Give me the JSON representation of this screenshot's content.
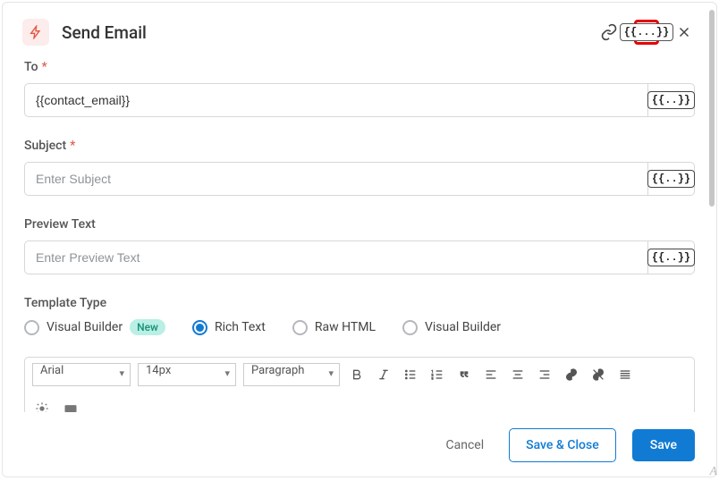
{
  "header": {
    "title": "Send Email"
  },
  "fields": {
    "to": {
      "label": "To",
      "required": true,
      "value": "{{contact_email}}",
      "placeholder": ""
    },
    "subject": {
      "label": "Subject",
      "required": true,
      "value": "",
      "placeholder": "Enter Subject"
    },
    "preview": {
      "label": "Preview Text",
      "required": false,
      "value": "",
      "placeholder": "Enter Preview Text"
    }
  },
  "template_type": {
    "label": "Template Type",
    "options": [
      {
        "label": "Visual Builder",
        "badge": "New",
        "selected": false
      },
      {
        "label": "Rich Text",
        "selected": true
      },
      {
        "label": "Raw HTML",
        "selected": false
      },
      {
        "label": "Visual Builder",
        "selected": false
      }
    ]
  },
  "toolbar": {
    "font": "Arial",
    "size": "14px",
    "block": "Paragraph"
  },
  "var_token": "{{...}}",
  "var_token_compact": "{{..}}",
  "footer": {
    "cancel": "Cancel",
    "save_close": "Save & Close",
    "save": "Save"
  }
}
